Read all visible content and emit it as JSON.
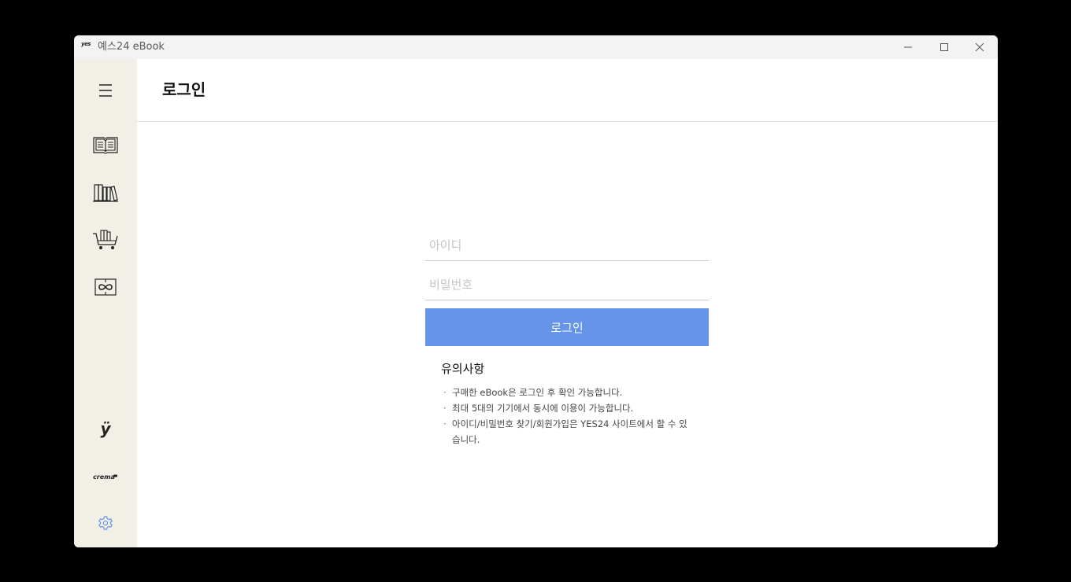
{
  "window": {
    "title": "예스24 eBook",
    "logo_text": "yes"
  },
  "sidebar": {
    "items": [
      {
        "name": "menu",
        "icon": "hamburger-menu-icon"
      },
      {
        "name": "library",
        "icon": "open-book-icon"
      },
      {
        "name": "bookshelf",
        "icon": "bookshelf-icon"
      },
      {
        "name": "cart",
        "icon": "shopping-cart-icon"
      },
      {
        "name": "unlimited",
        "icon": "infinity-book-icon"
      },
      {
        "name": "yes24",
        "icon": "yes24-logo-icon"
      },
      {
        "name": "crema",
        "icon": "crema-logo-icon"
      },
      {
        "name": "settings",
        "icon": "gear-icon"
      }
    ],
    "crema_label": "crema",
    "yes_label": "ÿ",
    "background": "#f2f0e6",
    "settings_color": "#6694e8"
  },
  "main": {
    "title": "로그인",
    "form": {
      "id_placeholder": "아이디",
      "password_placeholder": "비밀번호",
      "login_label": "로그인",
      "button_color": "#6694e8"
    },
    "notice": {
      "title": "유의사항",
      "items": [
        "구매한 eBook은 로그인 후 확인 가능합니다.",
        "최대 5대의 기기에서 동시에 이용이 가능합니다.",
        "아이디/비밀번호 찾기/회원가입은 YES24 사이트에서 할 수 있습니다."
      ]
    }
  }
}
